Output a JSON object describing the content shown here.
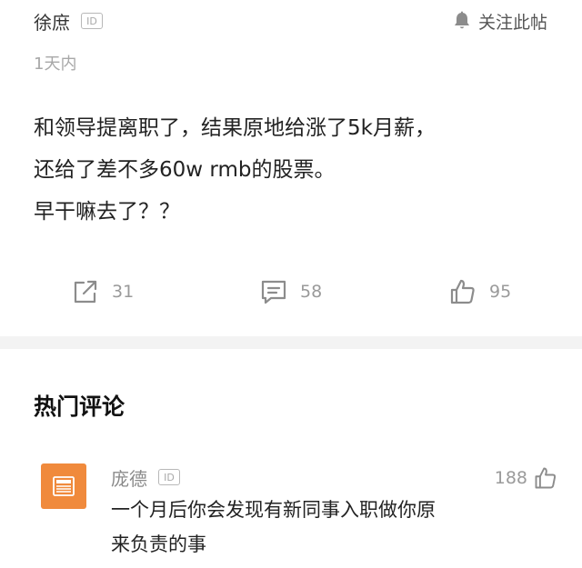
{
  "post": {
    "author": "徐庶",
    "id_badge": "ID",
    "follow_label": "关注此帖",
    "time": "1天内",
    "content_lines": [
      "和领导提离职了，结果原地给涨了5k月薪，",
      "还给了差不多60w rmb的股票。",
      "早干嘛去了？？"
    ],
    "actions": {
      "share_count": "31",
      "comment_count": "58",
      "like_count": "95"
    }
  },
  "hot_comments": {
    "title": "热门评论",
    "items": [
      {
        "author": "庞德",
        "id_badge": "ID",
        "likes": "188",
        "avatar_icon": "news-icon",
        "text_lines": [
          "一个月后你会发现有新同事入职做你原",
          "来负责的事"
        ]
      }
    ]
  },
  "colors": {
    "avatar_bg": "#f08a3c",
    "icon_gray": "#8c8c8c",
    "divider": "#f3f3f3"
  }
}
